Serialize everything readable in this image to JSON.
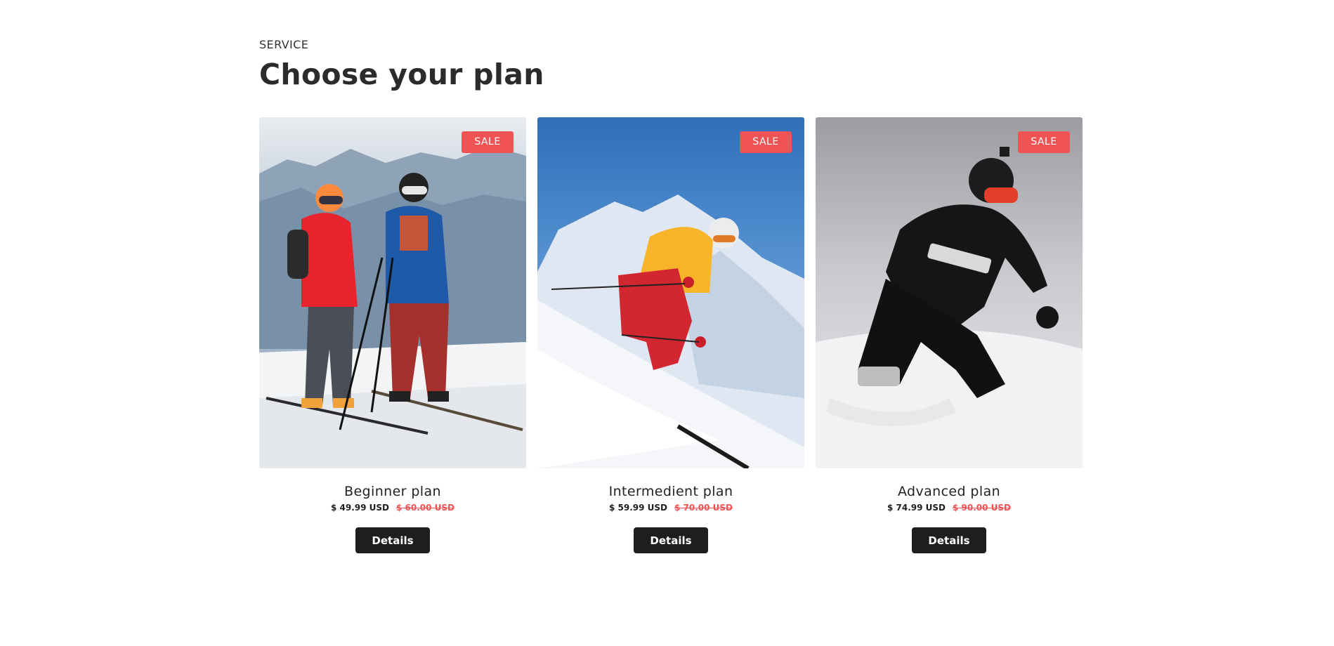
{
  "section": {
    "eyebrow": "SERVICE",
    "title": "Choose your plan"
  },
  "colors": {
    "sale_badge": "#f05353",
    "button": "#1e1e1e",
    "old_price": "#f05353"
  },
  "plans": [
    {
      "badge": "SALE",
      "name": "Beginner plan",
      "price": "$ 49.99 USD",
      "old_price": "$ 60.00 USD",
      "button": "Details",
      "image": "two-skiers-photo"
    },
    {
      "badge": "SALE",
      "name": "Intermedient plan",
      "price": "$ 59.99 USD",
      "old_price": "$ 70.00 USD",
      "button": "Details",
      "image": "skier-downhill-photo"
    },
    {
      "badge": "SALE",
      "name": "Advanced plan",
      "price": "$ 74.99 USD",
      "old_price": "$ 90.00 USD",
      "button": "Details",
      "image": "snowboarder-photo"
    }
  ]
}
